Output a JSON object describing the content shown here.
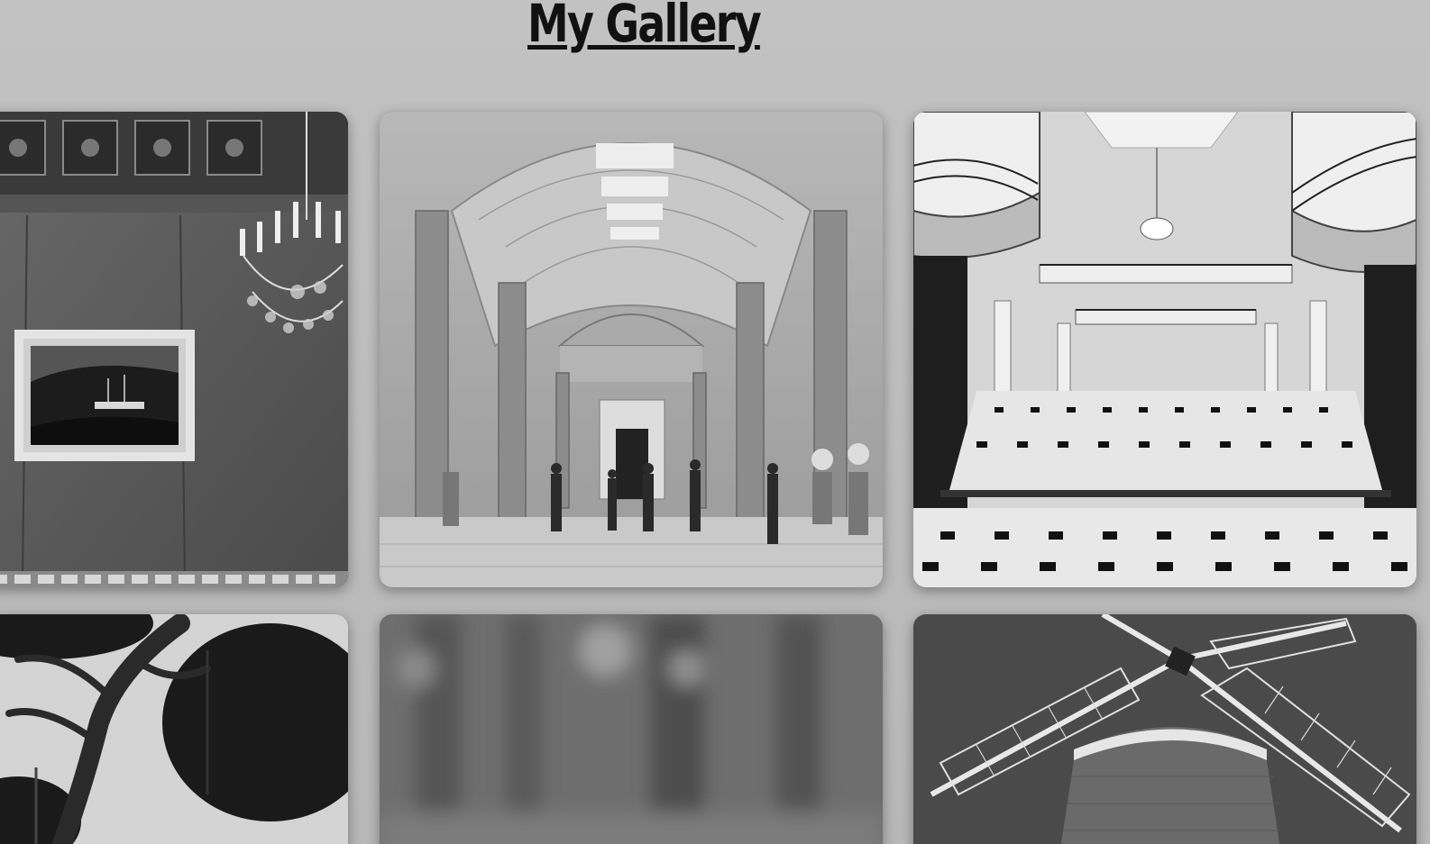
{
  "page": {
    "title": "My Gallery"
  },
  "gallery": {
    "images": [
      {
        "subject": "gallery-room-with-chandelier-and-ship-painting"
      },
      {
        "subject": "museum-hall-with-arched-skylight"
      },
      {
        "subject": "atrium-with-balconies-and-checkered-floor"
      },
      {
        "subject": "tree-branches-and-foliage"
      },
      {
        "subject": "blurred-forest-background"
      },
      {
        "subject": "windmill-against-sky"
      }
    ]
  },
  "theme": {
    "background": "#bdbdbd",
    "title_color": "#111111"
  }
}
